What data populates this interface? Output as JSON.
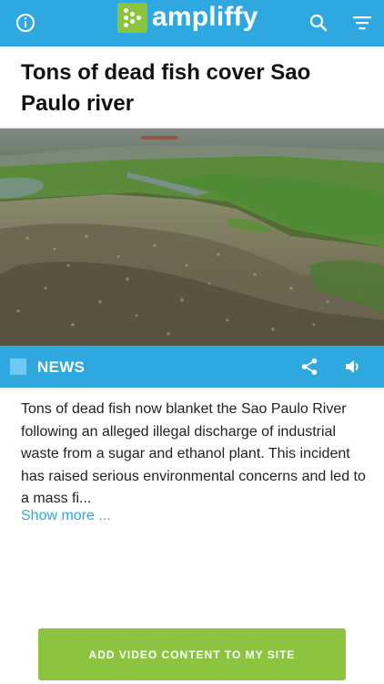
{
  "header": {
    "brand": "ampliffy",
    "icons": {
      "info": "info-icon",
      "search": "search-icon",
      "filter": "filter-icon"
    }
  },
  "article": {
    "title": "Tons of dead fish cover Sao Paulo river",
    "category": "NEWS",
    "description": "Tons of dead fish now blanket the Sao Paulo River following an alleged illegal discharge of industrial waste from a sugar and ethanol plant. This incident has raised serious environmental concerns and led to a mass fi...",
    "show_more": "Show more ...",
    "icons": {
      "share": "share-icon",
      "audio": "speaker-icon"
    }
  },
  "cta": {
    "label": "ADD VIDEO CONTENT TO MY SITE"
  },
  "colors": {
    "header_bg": "#2ea8df",
    "brand_green": "#8cc43f",
    "link": "#2ea8df"
  }
}
